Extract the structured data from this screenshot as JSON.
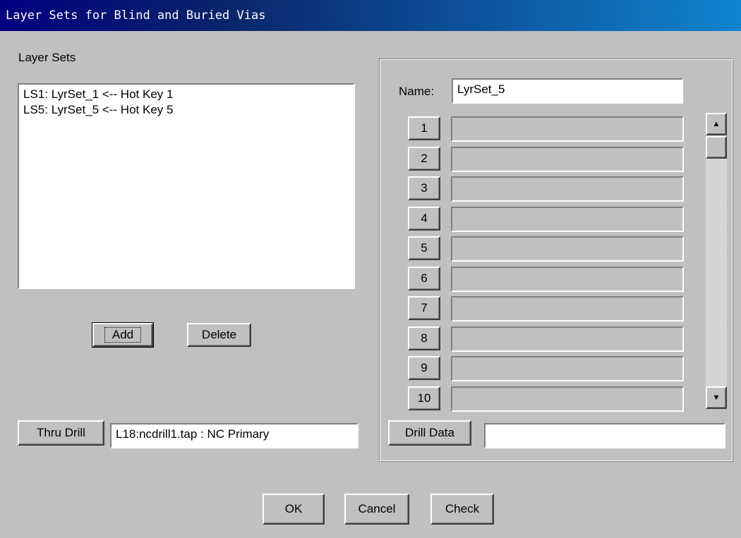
{
  "window": {
    "title": "Layer Sets for Blind and Buried Vias"
  },
  "layer_sets": {
    "label": "Layer Sets",
    "items": [
      "LS1: LyrSet_1 <-- Hot Key 1",
      "LS5: LyrSet_5 <-- Hot Key 5"
    ],
    "add_label": "Add",
    "delete_label": "Delete"
  },
  "thru_drill": {
    "button_label": "Thru Drill",
    "value": "L18:ncdrill1.tap  : NC Primary"
  },
  "editor": {
    "name_label": "Name:",
    "name_value": "LyrSet_5",
    "rows": [
      {
        "num": "1",
        "value": ""
      },
      {
        "num": "2",
        "value": ""
      },
      {
        "num": "3",
        "value": ""
      },
      {
        "num": "4",
        "value": ""
      },
      {
        "num": "5",
        "value": ""
      },
      {
        "num": "6",
        "value": ""
      },
      {
        "num": "7",
        "value": ""
      },
      {
        "num": "8",
        "value": ""
      },
      {
        "num": "9",
        "value": ""
      },
      {
        "num": "10",
        "value": ""
      }
    ],
    "drill_data_label": "Drill Data",
    "drill_data_value": ""
  },
  "footer": {
    "ok_label": "OK",
    "cancel_label": "Cancel",
    "check_label": "Check"
  }
}
